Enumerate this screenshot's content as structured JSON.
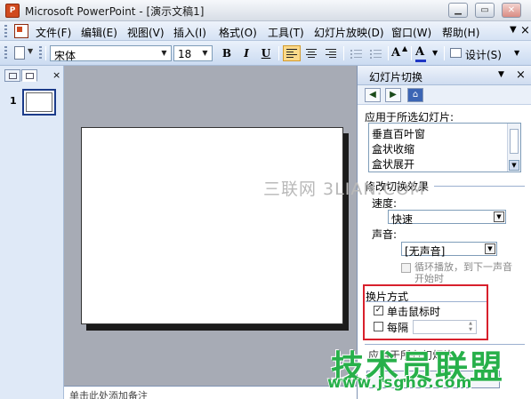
{
  "window": {
    "title": "Microsoft PowerPoint - [演示文稿1]",
    "app_icon_label": "P",
    "minimize_glyph": "▁",
    "restore_glyph": "▭",
    "close_glyph": "✕"
  },
  "menu": {
    "items": [
      "文件(F)",
      "编辑(E)",
      "视图(V)",
      "插入(I)",
      "格式(O)",
      "工具(T)",
      "幻灯片放映(D)",
      "窗口(W)",
      "帮助(H)"
    ],
    "close_glyph": "×"
  },
  "toolbar": {
    "font_name": "宋体",
    "font_size": "18",
    "bold_label": "B",
    "italic_label": "I",
    "underline_label": "U",
    "grow_font_label": "A",
    "font_color_label": "A",
    "design_label": "设计(S)",
    "dropdown_glyph": "▼",
    "font_color_hex": "#1f36c4",
    "active_button_color": "#fbd98a"
  },
  "outline_pane": {
    "slide_number": "1",
    "close_glyph": "×"
  },
  "notes": {
    "text": "单击此处添加备注"
  },
  "task_pane": {
    "title": "幻灯片切换",
    "close_glyph": "×",
    "nav": {
      "back_glyph": "◀",
      "forward_glyph": "▶",
      "home_glyph": "⌂"
    },
    "apply_label": "应用于所选幻灯片:",
    "transitions": [
      "垂直百叶窗",
      "盒状收缩",
      "盒状展开"
    ],
    "modify_label": "修改切换效果",
    "speed_label": "速度:",
    "speed_value": "快速",
    "sound_label": "声音:",
    "sound_value": "[无声音]",
    "loop_label_line1": "循环播放，到下一声音",
    "loop_label_line2": "开始时",
    "advance_label": "换片方式",
    "on_click_label": "单击鼠标时",
    "on_click_checked": true,
    "check_glyph": "✓",
    "every_label": "每隔",
    "every_value": "",
    "apply_all_label": "应用于所有幻灯片",
    "highlight_color": "#d8202c"
  },
  "watermarks": {
    "center_text": "三联网 3LIAN.COM",
    "logo_text": "技术员联盟",
    "url_text": "www.jsgho.com",
    "logo_color": "#27b04a"
  }
}
